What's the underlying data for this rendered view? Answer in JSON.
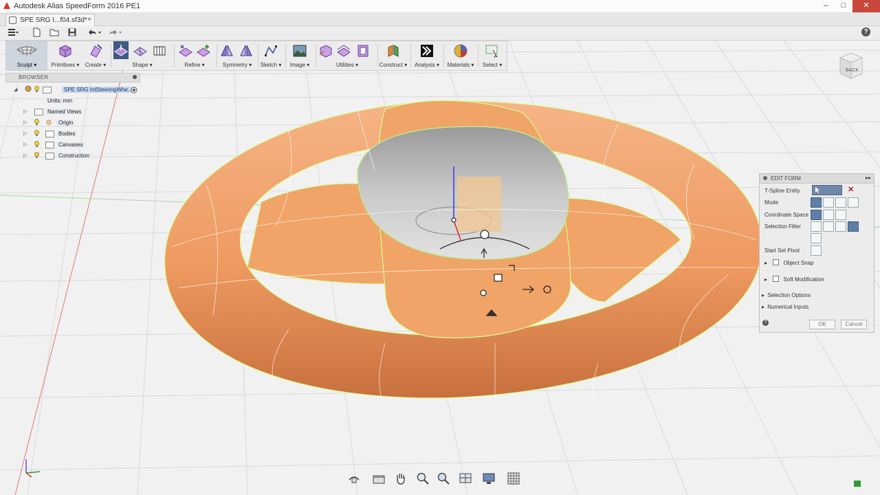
{
  "window": {
    "title": "Autodesk Alias SpeedForm 2016 PE1",
    "min_label": "–",
    "max_label": "□",
    "close_label": "✕"
  },
  "document_tab": {
    "label": "SPE SRG I...f04.sf3d*",
    "close_label": "×"
  },
  "toolbar": {
    "groups": [
      {
        "label": "Sculpt"
      },
      {
        "label": "Primitives"
      },
      {
        "label": "Create"
      },
      {
        "label": "Shape"
      },
      {
        "label": "Refine"
      },
      {
        "label": "Symmetry"
      },
      {
        "label": "Sketch"
      },
      {
        "label": "Image"
      },
      {
        "label": "Utilities"
      },
      {
        "label": "Construct"
      },
      {
        "label": "Analysis"
      },
      {
        "label": "Materials"
      },
      {
        "label": "Select"
      }
    ]
  },
  "browser": {
    "title": "BROWSER",
    "root": "SPE SRG IntSteeringWhe...",
    "items": [
      {
        "label": "Units: mm"
      },
      {
        "label": "Named Views"
      },
      {
        "label": "Origin"
      },
      {
        "label": "Bodies"
      },
      {
        "label": "Canvases"
      },
      {
        "label": "Construction"
      }
    ]
  },
  "viewcube": {
    "label": "BACK"
  },
  "edit_form": {
    "title": "EDIT FORM",
    "rows": {
      "tspline": "T-Spline Entity",
      "mode": "Mode",
      "coord": "Coordinate Space",
      "selfilter": "Selection Filter",
      "pivot": "Start Set Pivot",
      "objsnap": "Object Snap",
      "softmod": "Soft Modification",
      "selopts": "Selection Options",
      "numinputs": "Numerical Inputs"
    },
    "ok": "OK",
    "cancel": "Cancel",
    "help": "?"
  },
  "colors": {
    "body": "#f0a06a",
    "edge": "#d6ff8a",
    "accent": "#3e5a86"
  }
}
